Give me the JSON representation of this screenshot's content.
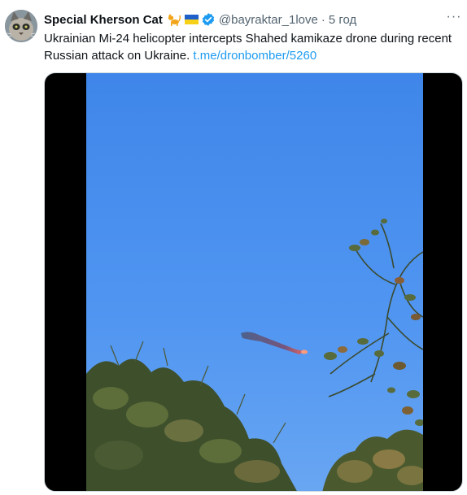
{
  "tweet": {
    "author_name": "Special Kherson Cat",
    "handle": "@bayraktar_1love",
    "separator": "·",
    "time": "5 год",
    "more_label": "···",
    "text": "Ukrainian Mi-24 helicopter intercepts Shahed kamikaze drone during recent Russian attack on Ukraine. ",
    "link_text": "t.me/dronbomber/5260"
  },
  "icons": {
    "author_emojis": [
      "cat-emoji-icon",
      "ukraine-flag-icon"
    ],
    "verified": "verified-badge-icon",
    "more": "more-options-icon"
  },
  "colors": {
    "link": "#1d9bf0",
    "verified": "#1d9bf0",
    "secondary_text": "#536471",
    "sky": "#4a8ff0"
  }
}
